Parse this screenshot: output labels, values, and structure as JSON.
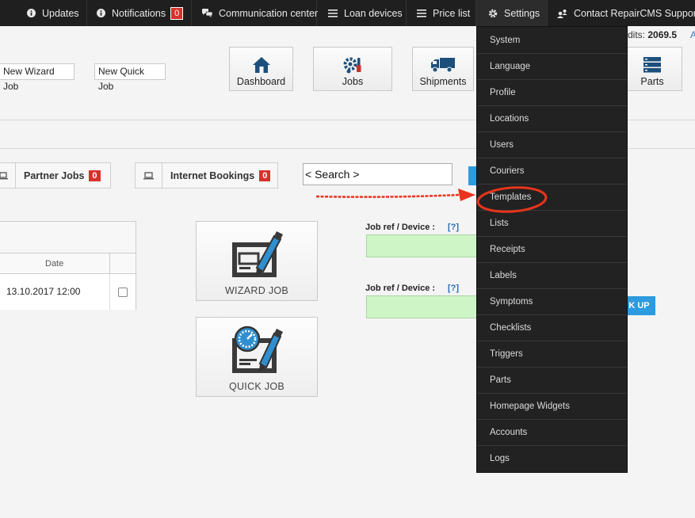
{
  "topbar": {
    "items": [
      {
        "label": "Updates",
        "icon": "info-icon"
      },
      {
        "label": "Notifications",
        "icon": "info-icon",
        "badge": "0"
      },
      {
        "label": "Communication center",
        "icon": "chat-icon"
      },
      {
        "label": "Loan devices",
        "icon": "list-icon"
      },
      {
        "label": "Price list",
        "icon": "list-icon"
      },
      {
        "label": "Settings",
        "icon": "gear-icon"
      },
      {
        "label": "Contact RepairCMS Support",
        "icon": "support-icon"
      }
    ]
  },
  "header": {
    "new_wizard_job": "New Wizard Job",
    "new_quick_job": "New Quick Job",
    "credits_label": "dits:",
    "credits_value": "2069.5",
    "credits_link": "A",
    "nav_buttons": [
      {
        "label": "Dashboard",
        "icon": "home-icon"
      },
      {
        "label": "Jobs",
        "icon": "tools-icon"
      },
      {
        "label": "Shipments",
        "icon": "truck-icon"
      },
      {
        "label": "Parts",
        "icon": "server-icon"
      }
    ]
  },
  "tabs": [
    {
      "label": "Partner Jobs",
      "badge": "0"
    },
    {
      "label": "Internet Bookings",
      "badge": "0"
    }
  ],
  "search": {
    "value": "< Search >"
  },
  "table": {
    "header_date": "Date",
    "rows": [
      {
        "date": "13.10.2017 12:00"
      }
    ]
  },
  "tiles": {
    "wizard_label": "WIZARD JOB",
    "quick_label": "QUICK JOB"
  },
  "job_ref": {
    "label": "Job ref / Device :",
    "help": "[?]",
    "lookup_button": "K UP"
  },
  "settings_menu": {
    "items": [
      "System",
      "Language",
      "Profile",
      "Locations",
      "Users",
      "Couriers",
      "Templates",
      "Lists",
      "Receipts",
      "Labels",
      "Symptoms",
      "Checklists",
      "Triggers",
      "Parts",
      "Homepage Widgets",
      "Accounts",
      "Logs"
    ],
    "highlighted": "Templates"
  },
  "colors": {
    "navbar_bg": "#1f1f1f",
    "badge_red": "#d9302c",
    "accent_blue": "#2d9be0",
    "highlight_red": "#e8341c",
    "input_green": "#cdf5c6"
  }
}
